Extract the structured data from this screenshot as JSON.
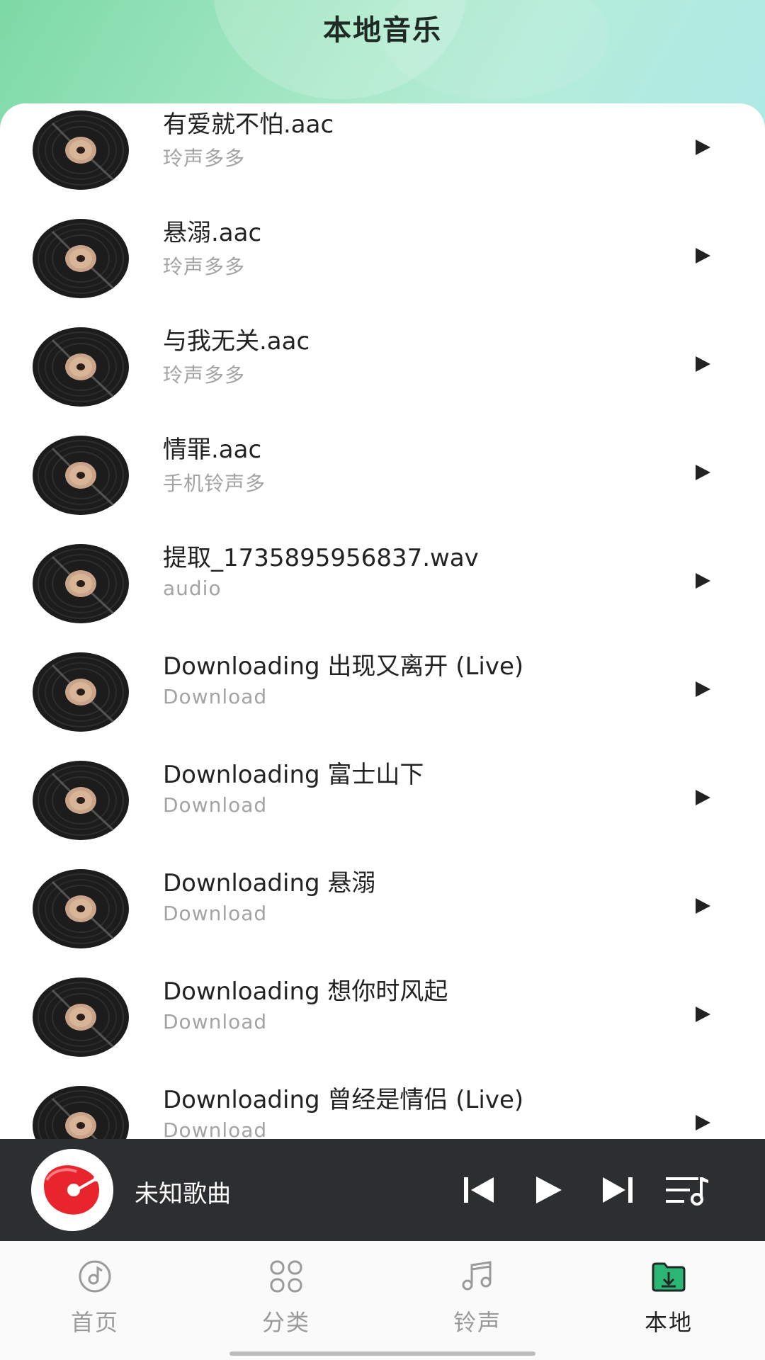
{
  "header": {
    "title": "本地音乐"
  },
  "songs": [
    {
      "title": "有爱就不怕.aac",
      "artist": "玲声多多"
    },
    {
      "title": "悬溺.aac",
      "artist": "玲声多多"
    },
    {
      "title": "与我无关.aac",
      "artist": "玲声多多"
    },
    {
      "title": "情罪.aac",
      "artist": "手机铃声多"
    },
    {
      "title": "提取_1735895956837.wav",
      "artist": "audio"
    },
    {
      "title": "Downloading 出现又离开 (Live)",
      "artist": "Download"
    },
    {
      "title": "Downloading 富士山下",
      "artist": "Download"
    },
    {
      "title": "Downloading 悬溺",
      "artist": "Download"
    },
    {
      "title": "Downloading 想你时风起",
      "artist": "Download"
    },
    {
      "title": "Downloading 曾经是情侣 (Live)",
      "artist": "Download"
    }
  ],
  "player": {
    "title": "未知歌曲"
  },
  "nav": {
    "items": [
      {
        "label": "首页",
        "icon": "home-music-icon",
        "active": false
      },
      {
        "label": "分类",
        "icon": "category-grid-icon",
        "active": false
      },
      {
        "label": "铃声",
        "icon": "ringtone-note-icon",
        "active": false
      },
      {
        "label": "本地",
        "icon": "local-folder-icon",
        "active": true
      }
    ]
  },
  "colors": {
    "header_gradient_start": "#7dd9a6",
    "header_gradient_end": "#aeeae6",
    "player_bg": "#2d2e30",
    "active_tab": "#222222",
    "inactive_tab": "#9a9a9a",
    "accent_green": "#2bb673"
  }
}
